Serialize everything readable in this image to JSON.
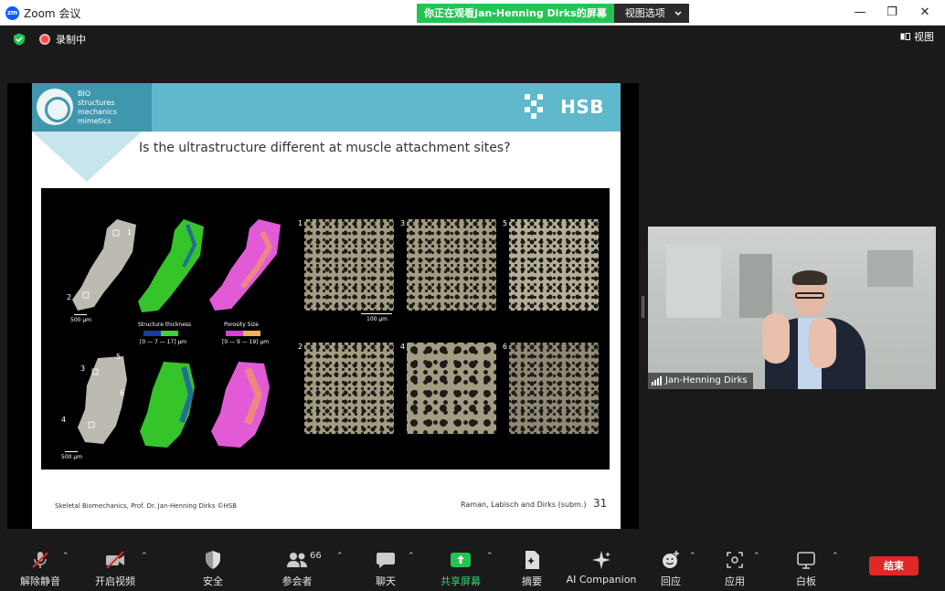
{
  "window": {
    "app_logo": "zm",
    "title": "Zoom 会议",
    "share_banner": "你正在观看Jan-Henning Dirks的屏幕",
    "view_options": "视图选项",
    "controls": {
      "minimize": "—",
      "restore": "❐",
      "close": "✕"
    }
  },
  "meeting_bar": {
    "recording_label": "录制中",
    "view_label": "视图"
  },
  "slide": {
    "logo_lines": [
      "BIO",
      "structures",
      "mechanics",
      "mimetics"
    ],
    "brand": "HSB",
    "title": "Is the ultrastructure different at muscle attachment sites?",
    "figure": {
      "scale_500_top": "500 µm",
      "scale_500_bottom": "500 µm",
      "scale_100": "100 µm",
      "structure_thickness": "Structure thickness",
      "structure_range": "[0 — 7 — 17] µm",
      "porosity_size": "Porosity Size",
      "porosity_range": "[0 — 9 — 19] µm",
      "bone_labels": [
        "1",
        "2",
        "3",
        "4",
        "5",
        "6"
      ],
      "panel_labels": [
        "1",
        "2",
        "3",
        "4",
        "5",
        "6"
      ]
    },
    "footer_left": "Skeletal Biomechanics, Prof. Dr. Jan-Henning Dirks ©HSB",
    "footer_right": "Raman, Labisch and Dirks (subm.)",
    "page_number": "31"
  },
  "video": {
    "participant_name": "Jan-Henning Dirks"
  },
  "toolbar": {
    "unmute": "解除静音",
    "start_video": "开启视频",
    "security": "安全",
    "participants": "参会者",
    "participants_count": "66",
    "chat": "聊天",
    "share_screen": "共享屏幕",
    "summary": "摘要",
    "ai_companion": "AI Companion",
    "reactions": "回应",
    "apps": "应用",
    "whiteboard": "白板",
    "end": "结束"
  },
  "colors": {
    "share_green": "#23c552",
    "end_red": "#e02828",
    "slide_header": "#5fb8cc"
  }
}
